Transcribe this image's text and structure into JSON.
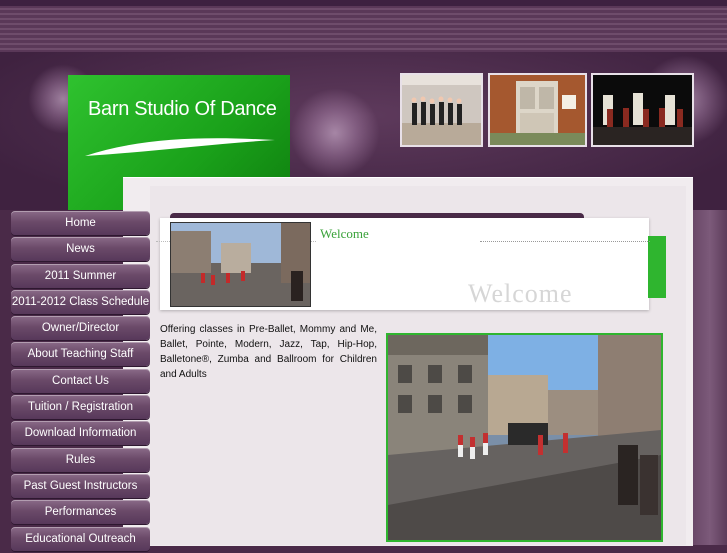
{
  "site": {
    "title": "Barn Studio Of Dance"
  },
  "nav": {
    "items": [
      {
        "label": "Home"
      },
      {
        "label": "News"
      },
      {
        "label": "2011 Summer"
      },
      {
        "label": "2011-2012 Class Schedule"
      },
      {
        "label": "Owner/Director"
      },
      {
        "label": "About Teaching Staff"
      },
      {
        "label": "Contact Us"
      },
      {
        "label": "Tuition / Registration"
      },
      {
        "label": "Download Information"
      },
      {
        "label": "Rules"
      },
      {
        "label": "Past Guest Instructors"
      },
      {
        "label": "Performances"
      },
      {
        "label": "Educational Outreach"
      }
    ]
  },
  "main": {
    "welcome_heading": "Welcome",
    "welcome_watermark": "Welcome",
    "intro_text": "Offering classes in Pre-Ballet, Mommy and Me, Ballet, Pointe, Modern, Jazz, Tap, Hip-Hop, Balletone®, Zumba and Ballroom for Children and Adults"
  },
  "colors": {
    "brand_green": "#2fb52f",
    "brand_purple": "#4a2a48"
  }
}
